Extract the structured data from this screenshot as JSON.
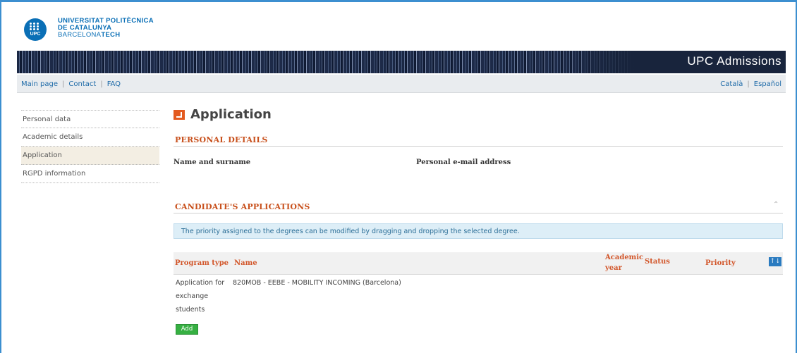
{
  "header": {
    "logo_text": "UPC",
    "university_line1": "UNIVERSITAT POLITÈCNICA",
    "university_line2": "DE CATALUNYA",
    "university_line3_a": "BARCELONA",
    "university_line3_b": "TECH",
    "banner_title": "UPC Admissions"
  },
  "nav": {
    "main_page": "Main page",
    "contact": "Contact",
    "faq": "FAQ",
    "sep": "|",
    "catala": "Català",
    "espanol": "Español"
  },
  "sidebar": {
    "items": [
      {
        "label": "Personal data"
      },
      {
        "label": "Academic details"
      },
      {
        "label": "Application"
      },
      {
        "label": "RGPD information"
      }
    ]
  },
  "main": {
    "title": "Application",
    "personal_details": {
      "heading": "PERSONAL DETAILS",
      "name_label": "Name and surname",
      "email_label": "Personal e-mail address"
    },
    "applications": {
      "heading": "CANDIDATE'S APPLICATIONS",
      "info": "The priority assigned to the degrees can be modified by dragging and dropping the selected degree.",
      "columns": {
        "program_type": "Program type",
        "name": "Name",
        "academic_year_1": "Academic",
        "academic_year_2": "year",
        "status": "Status",
        "priority": "Priority"
      },
      "rows": [
        {
          "program_type_1": "Application for",
          "program_type_2": "exchange",
          "program_type_3": "students",
          "name": "820MOB - EEBE - MOBILITY INCOMING (Barcelona)"
        }
      ],
      "add_label": "Add"
    }
  },
  "colors": {
    "accent_orange": "#c8501c",
    "link_blue": "#1d6aa8",
    "add_green": "#36b042",
    "info_bg": "#ddeef7"
  }
}
